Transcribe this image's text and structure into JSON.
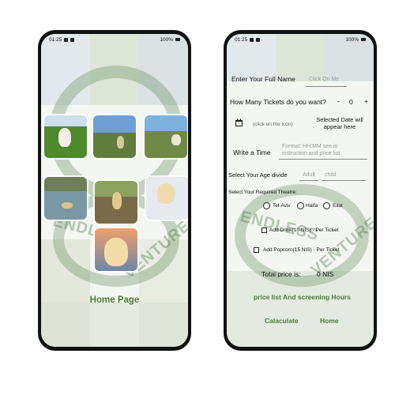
{
  "left_phone": {
    "status": {
      "time": "01:25",
      "battery": "100%"
    },
    "title": "Home Page"
  },
  "right_phone": {
    "status": {
      "time": "01:25",
      "battery": "100%"
    },
    "full_name": {
      "label": "Enter Your Full Name",
      "placeholder": "Click On Me"
    },
    "tickets": {
      "label": "How Many Tickets do you want?",
      "minus": "-",
      "count": "0",
      "plus": "+"
    },
    "date": {
      "hint": "(click on the icon)",
      "selected": "Selected Date will appear here"
    },
    "time": {
      "label": "Write a Time",
      "placeholder": "Format: HH:MM see in instruction and price list"
    },
    "age": {
      "label": "Select Your Age divide",
      "adult": "Adult",
      "child": "child"
    },
    "theatre": {
      "label": "Select Your Required Theatre:",
      "options": [
        "Tel-Aviv",
        "Haifa",
        "Eilat"
      ]
    },
    "extras": {
      "drink": "Add Drink(10 NIS) - Per Ticket",
      "popcorn": "Add Popcorn(15 NIS)  - Per Ticket"
    },
    "total": {
      "label": "Total price is:",
      "value": "0 NIS"
    },
    "price_list_link": "price list And screening Hours",
    "calculate_button": "Calaculate",
    "home_button": "Home"
  }
}
